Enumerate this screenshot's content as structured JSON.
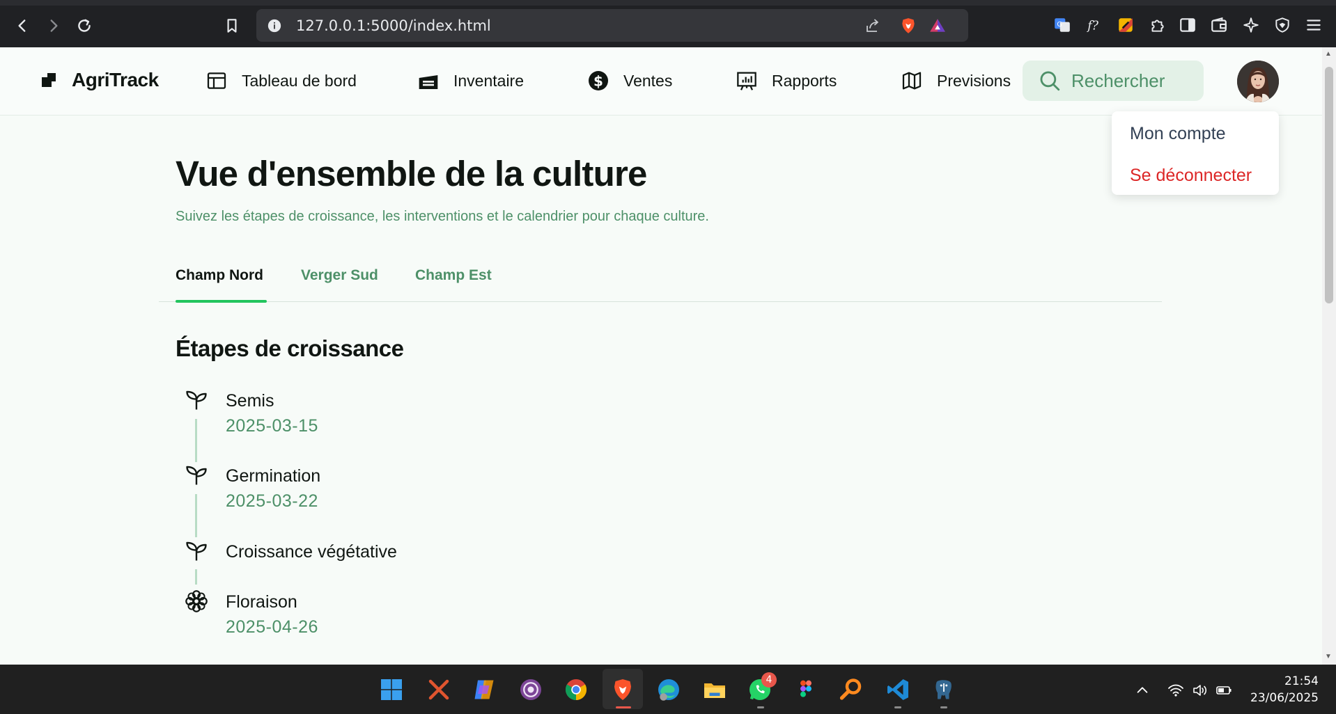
{
  "browser": {
    "url": "127.0.0.1:5000/index.html"
  },
  "app": {
    "brand": "AgriTrack",
    "nav": [
      {
        "label": "Tableau de bord",
        "icon": "layout-icon"
      },
      {
        "label": "Inventaire",
        "icon": "warehouse-icon"
      },
      {
        "label": "Ventes",
        "icon": "dollar-icon"
      },
      {
        "label": "Rapports",
        "icon": "presentation-chart-icon"
      },
      {
        "label": "Previsions",
        "icon": "map-icon"
      }
    ],
    "search": {
      "placeholder": "Rechercher"
    },
    "user_menu": {
      "account": "Mon compte",
      "logout": "Se déconnecter"
    }
  },
  "main": {
    "title": "Vue d'ensemble de la culture",
    "subtitle": "Suivez les étapes de croissance, les interventions et le calendrier pour chaque culture.",
    "tabs": [
      {
        "label": "Champ Nord",
        "active": true
      },
      {
        "label": "Verger Sud",
        "active": false
      },
      {
        "label": "Champ Est",
        "active": false
      }
    ],
    "section_title": "Étapes de croissance",
    "stages": [
      {
        "name": "Semis",
        "date": "2025-03-15",
        "icon": "sprout-icon"
      },
      {
        "name": "Germination",
        "date": "2025-03-22",
        "icon": "sprout-icon"
      },
      {
        "name": "Croissance végétative",
        "date": "",
        "icon": "sprout-icon"
      },
      {
        "name": "Floraison",
        "date": "2025-04-26",
        "icon": "flower-icon"
      }
    ]
  },
  "taskbar": {
    "time": "21:54",
    "date": "23/06/2025",
    "whatsapp_badge": "4"
  },
  "colors": {
    "accent_green": "#22c55e",
    "muted_green": "#4d9068",
    "logout_red": "#dc2626",
    "search_bg": "#e3f1e7"
  }
}
